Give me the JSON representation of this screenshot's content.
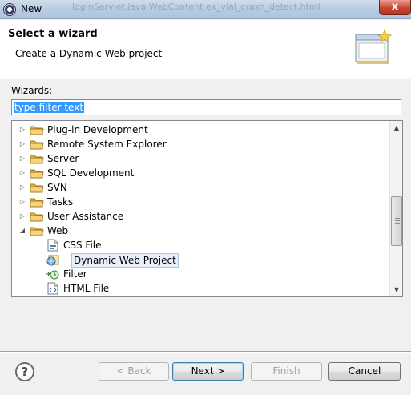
{
  "window": {
    "title": "New",
    "close_label": "x",
    "ghost_text": "loginServlet.java    WebContent    ex_vial_crash_detect.html"
  },
  "banner": {
    "heading": "Select a wizard",
    "description": "Create a Dynamic Web project"
  },
  "wizards_label": "Wizards:",
  "filter": {
    "value": "type filter text"
  },
  "tree": {
    "items": [
      {
        "label": "Plug-in Development",
        "type": "folder",
        "expanded": false
      },
      {
        "label": "Remote System Explorer",
        "type": "folder",
        "expanded": false
      },
      {
        "label": "Server",
        "type": "folder",
        "expanded": false
      },
      {
        "label": "SQL Development",
        "type": "folder",
        "expanded": false
      },
      {
        "label": "SVN",
        "type": "folder",
        "expanded": false
      },
      {
        "label": "Tasks",
        "type": "folder",
        "expanded": false
      },
      {
        "label": "User Assistance",
        "type": "folder",
        "expanded": false
      },
      {
        "label": "Web",
        "type": "folder",
        "expanded": true
      },
      {
        "label": "CSS File",
        "type": "css-file-icon"
      },
      {
        "label": "Dynamic Web Project",
        "type": "web-project-icon",
        "selected": true
      },
      {
        "label": "Filter",
        "type": "filter-icon"
      },
      {
        "label": "HTML File",
        "type": "html-file-icon"
      }
    ]
  },
  "buttons": {
    "help": "?",
    "back": "< Back",
    "next": "Next >",
    "finish": "Finish",
    "cancel": "Cancel"
  }
}
